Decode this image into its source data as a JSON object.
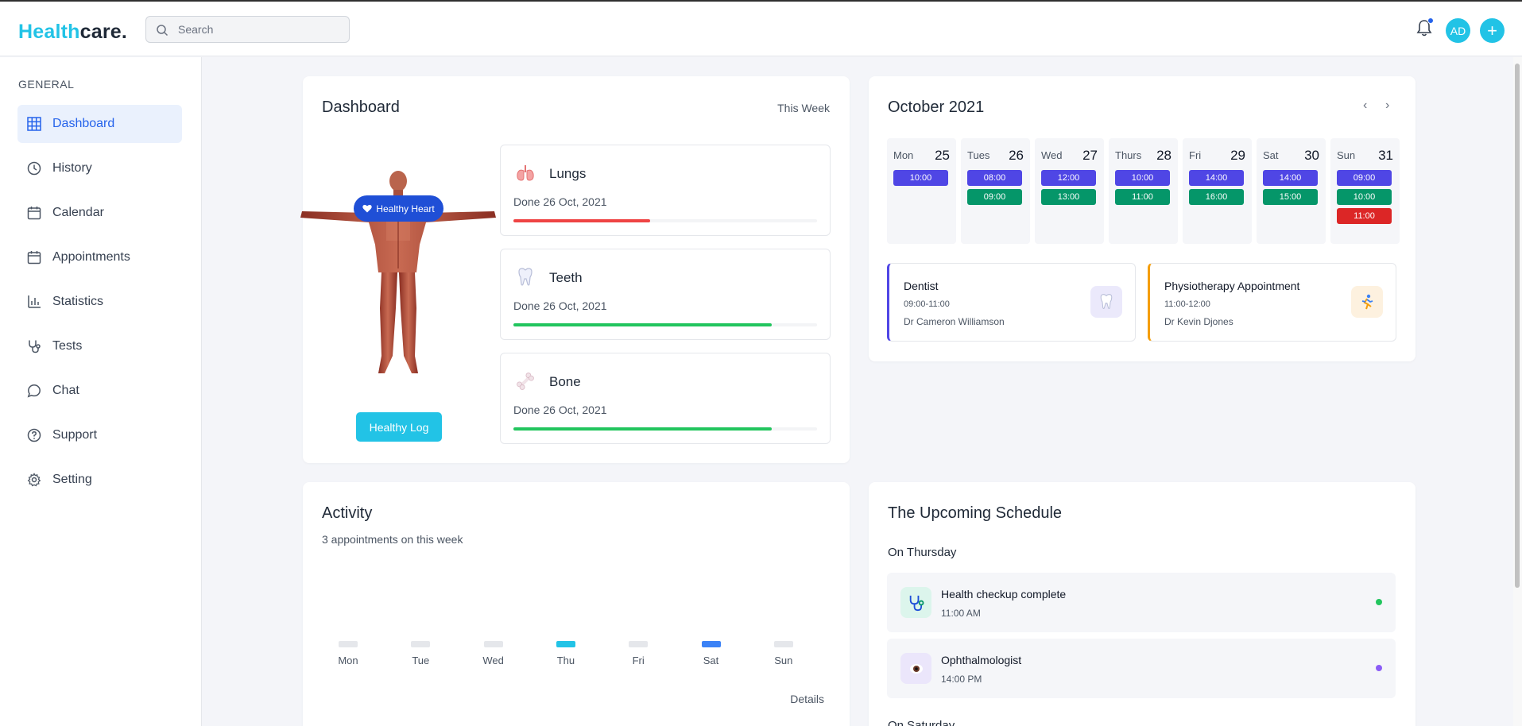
{
  "app": {
    "logo_part1": "Health",
    "logo_part2": "care."
  },
  "header": {
    "search_placeholder": "Search",
    "avatar_initials": "AD",
    "plus": "+"
  },
  "sidebar": {
    "section_title": "GENERAL",
    "items": [
      {
        "label": "Dashboard",
        "icon": "grid-icon",
        "active": true
      },
      {
        "label": "History",
        "icon": "clock-icon"
      },
      {
        "label": "Calendar",
        "icon": "calendar-icon"
      },
      {
        "label": "Appointments",
        "icon": "calendar-icon"
      },
      {
        "label": "Statistics",
        "icon": "bar-chart-icon"
      },
      {
        "label": "Tests",
        "icon": "stethoscope-icon"
      },
      {
        "label": "Chat",
        "icon": "chat-icon"
      },
      {
        "label": "Support",
        "icon": "help-circle-icon"
      },
      {
        "label": "Setting",
        "icon": "gear-icon"
      }
    ]
  },
  "dashboard": {
    "title": "Dashboard",
    "range": "This Week",
    "badge": "Healthy Heart",
    "log_button": "Healthy Log",
    "organs": [
      {
        "name": "Lungs",
        "date": "Done 26 Oct, 2021",
        "progress": 0.45,
        "color": "#ef4444",
        "icon": "lungs-icon"
      },
      {
        "name": "Teeth",
        "date": "Done 26 Oct, 2021",
        "progress": 0.85,
        "color": "#22c55e",
        "icon": "tooth-icon"
      },
      {
        "name": "Bone",
        "date": "Done 26 Oct, 2021",
        "progress": 0.85,
        "color": "#22c55e",
        "icon": "bone-icon"
      }
    ]
  },
  "calendar": {
    "title": "October 2021",
    "prev": "‹",
    "next": "›",
    "days": [
      {
        "name": "Mon",
        "num": "25",
        "slots": [
          {
            "time": "10:00",
            "color": "#4f46e5"
          }
        ]
      },
      {
        "name": "Tues",
        "num": "26",
        "slots": [
          {
            "time": "08:00",
            "color": "#4f46e5"
          },
          {
            "time": "09:00",
            "color": "#059669"
          }
        ]
      },
      {
        "name": "Wed",
        "num": "27",
        "slots": [
          {
            "time": "12:00",
            "color": "#4f46e5"
          },
          {
            "time": "13:00",
            "color": "#059669"
          }
        ]
      },
      {
        "name": "Thurs",
        "num": "28",
        "slots": [
          {
            "time": "10:00",
            "color": "#4f46e5"
          },
          {
            "time": "11:00",
            "color": "#059669"
          }
        ]
      },
      {
        "name": "Fri",
        "num": "29",
        "slots": [
          {
            "time": "14:00",
            "color": "#4f46e5"
          },
          {
            "time": "16:00",
            "color": "#059669"
          }
        ]
      },
      {
        "name": "Sat",
        "num": "30",
        "slots": [
          {
            "time": "14:00",
            "color": "#4f46e5"
          },
          {
            "time": "15:00",
            "color": "#059669"
          }
        ]
      },
      {
        "name": "Sun",
        "num": "31",
        "slots": [
          {
            "time": "09:00",
            "color": "#4f46e5"
          },
          {
            "time": "10:00",
            "color": "#059669"
          },
          {
            "time": "11:00",
            "color": "#dc2626"
          }
        ]
      }
    ],
    "appointments": [
      {
        "title": "Dentist",
        "time": "09:00-11:00",
        "doctor": "Dr Cameron Williamson",
        "accent": "#4f46e5",
        "icon": "tooth-icon"
      },
      {
        "title": "Physiotherapy Appointment",
        "time": "11:00-12:00",
        "doctor": "Dr Kevin Djones",
        "accent": "#f59e0b",
        "icon": "runner-icon"
      }
    ]
  },
  "activity": {
    "title": "Activity",
    "subtitle": "3 appointments on this week",
    "details": "Details",
    "days": [
      "Mon",
      "Tue",
      "Wed",
      "Thu",
      "Fri",
      "Sat",
      "Sun"
    ],
    "bar_colors": [
      "#e5e7eb",
      "#e5e7eb",
      "#e5e7eb",
      "#22c3e6",
      "#e5e7eb",
      "#3b82f6",
      "#e5e7eb"
    ]
  },
  "upcoming": {
    "title": "The Upcoming Schedule",
    "subtitle": "On Thursday",
    "items": [
      {
        "title": "Health checkup complete",
        "time": "11:00 AM",
        "dot": "#22c55e",
        "icon": "stethoscope-icon"
      },
      {
        "title": "Ophthalmologist",
        "time": "14:00 PM",
        "dot": "#8b5cf6",
        "icon": "eye-icon"
      }
    ],
    "next_subtitle": "On Saturday"
  }
}
